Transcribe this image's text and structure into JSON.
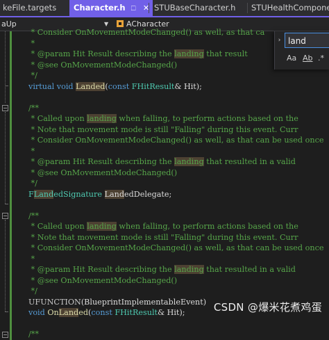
{
  "tabs": [
    {
      "label": "keFile.targets",
      "active": false
    },
    {
      "label": "Character.h",
      "active": true
    },
    {
      "label": "STUBaseCharacter.h",
      "active": false
    },
    {
      "label": "STUHealthComponent.h",
      "active": false
    }
  ],
  "nav": {
    "scope": "aUp",
    "class_name": "ACharacter"
  },
  "find": {
    "query": "land",
    "match_case_label": "Aa",
    "whole_word_label": "Ab",
    "regex_label": ".*"
  },
  "code_lines": [
    [
      {
        "t": " * Consider OnMovementModeChanged() as well, as that ca",
        "c": "c"
      }
    ],
    [
      {
        "t": " *",
        "c": "c"
      }
    ],
    [
      {
        "t": " * @param Hit Result describing the ",
        "c": "c"
      },
      {
        "t": "landing",
        "c": "c hl"
      },
      {
        "t": " that result",
        "c": "c"
      }
    ],
    [
      {
        "t": " * @see OnMovementModeChanged()",
        "c": "c"
      }
    ],
    [
      {
        "t": " */",
        "c": "c"
      }
    ],
    [
      {
        "t": "virtual",
        "c": "kw"
      },
      {
        "t": " ",
        "c": ""
      },
      {
        "t": "void",
        "c": "kw"
      },
      {
        "t": " ",
        "c": ""
      },
      {
        "t": "Landed",
        "c": "fn hl"
      },
      {
        "t": "(",
        "c": ""
      },
      {
        "t": "const",
        "c": "kw"
      },
      {
        "t": " ",
        "c": ""
      },
      {
        "t": "FHitResult",
        "c": "ty"
      },
      {
        "t": "& Hit);",
        "c": ""
      }
    ],
    [
      {
        "t": "",
        "c": ""
      }
    ],
    [
      {
        "t": "/**",
        "c": "c"
      }
    ],
    [
      {
        "t": " * Called upon ",
        "c": "c"
      },
      {
        "t": "landing",
        "c": "c hl"
      },
      {
        "t": " when falling, to perform actions based on the",
        "c": "c"
      }
    ],
    [
      {
        "t": " * Note that movement mode is still \"Falling\" during this event. Curr",
        "c": "c"
      }
    ],
    [
      {
        "t": " * Consider OnMovementModeChanged() as well, as that can be used once",
        "c": "c"
      }
    ],
    [
      {
        "t": " *",
        "c": "c"
      }
    ],
    [
      {
        "t": " * @param Hit Result describing the ",
        "c": "c"
      },
      {
        "t": "landing",
        "c": "c hl"
      },
      {
        "t": " that resulted in a valid",
        "c": "c"
      }
    ],
    [
      {
        "t": " * @see OnMovementModeChanged()",
        "c": "c"
      }
    ],
    [
      {
        "t": " */",
        "c": "c"
      }
    ],
    [
      {
        "t": "F",
        "c": "ty"
      },
      {
        "t": "Land",
        "c": "ty hl"
      },
      {
        "t": "edSignature",
        "c": "ty"
      },
      {
        "t": " ",
        "c": ""
      },
      {
        "t": "Land",
        "c": "hl"
      },
      {
        "t": "edDelegate;",
        "c": ""
      }
    ],
    [
      {
        "t": "",
        "c": ""
      }
    ],
    [
      {
        "t": "/**",
        "c": "c"
      }
    ],
    [
      {
        "t": " * Called upon ",
        "c": "c"
      },
      {
        "t": "landing",
        "c": "c hl"
      },
      {
        "t": " when falling, to perform actions based on the",
        "c": "c"
      }
    ],
    [
      {
        "t": " * Note that movement mode is still \"Falling\" during this event. Curr",
        "c": "c"
      }
    ],
    [
      {
        "t": " * Consider OnMovementModeChanged() as well, as that can be used once",
        "c": "c"
      }
    ],
    [
      {
        "t": " *",
        "c": "c"
      }
    ],
    [
      {
        "t": " * @param Hit Result describing the ",
        "c": "c"
      },
      {
        "t": "landing",
        "c": "c hl"
      },
      {
        "t": " that resulted in a valid",
        "c": "c"
      }
    ],
    [
      {
        "t": " * @see OnMovementModeChanged()",
        "c": "c"
      }
    ],
    [
      {
        "t": " */",
        "c": "c"
      }
    ],
    [
      {
        "t": "UFUNCTION",
        "c": "mc"
      },
      {
        "t": "(BlueprintImplementableEvent)",
        "c": ""
      }
    ],
    [
      {
        "t": "void",
        "c": "kw"
      },
      {
        "t": " On",
        "c": "fn"
      },
      {
        "t": "Land",
        "c": "fn hl"
      },
      {
        "t": "ed",
        "c": "fn"
      },
      {
        "t": "(",
        "c": ""
      },
      {
        "t": "const",
        "c": "kw"
      },
      {
        "t": " ",
        "c": ""
      },
      {
        "t": "FHitResult",
        "c": "ty"
      },
      {
        "t": "& Hit);",
        "c": ""
      }
    ],
    [
      {
        "t": "",
        "c": ""
      }
    ],
    [
      {
        "t": "/**",
        "c": "c"
      }
    ]
  ],
  "colors": {
    "accent_tab": "#7160e8",
    "comment": "#57a64a",
    "keyword": "#569cd6",
    "type": "#4ec9b0",
    "function": "#dcdcaa",
    "search_highlight": "#4d4132"
  },
  "icons": {
    "tab_pin": "pin-icon",
    "tab_close": "close-icon",
    "find_expand": "chevron-right-icon",
    "class_icon": "class-icon"
  },
  "watermark": "CSDN @爆米花煮鸡蛋"
}
